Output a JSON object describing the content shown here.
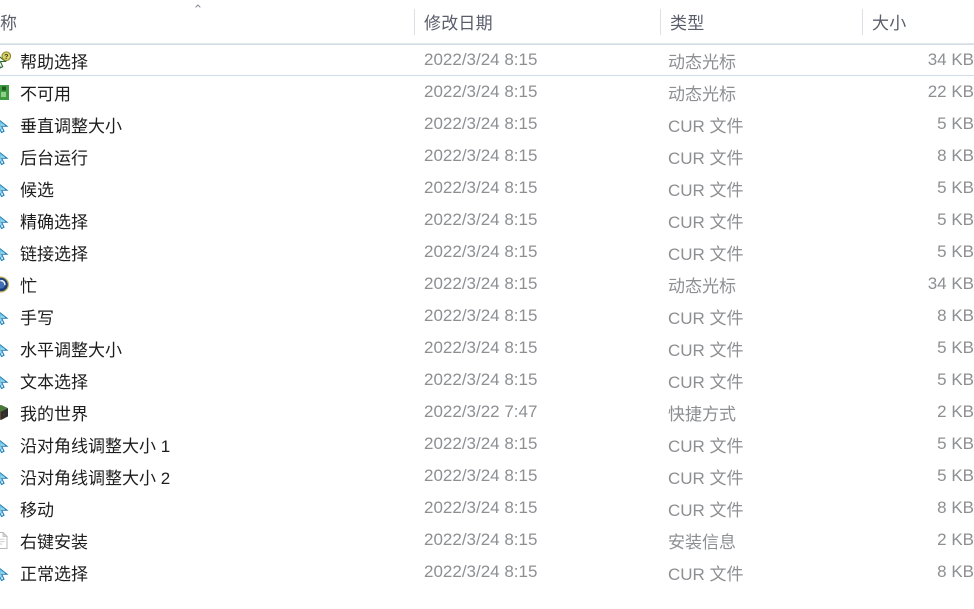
{
  "window": {
    "view": "details-list"
  },
  "columns": {
    "name": {
      "label": "称",
      "sort": "ascending",
      "sort_glyph": "⌃"
    },
    "date": {
      "label": "修改日期"
    },
    "type": {
      "label": "类型"
    },
    "size": {
      "label": "大小"
    }
  },
  "rows": [
    {
      "name": "帮助选择",
      "date": "2022/3/24 8:15",
      "type": "动态光标",
      "size": "34 KB",
      "icon": "ani-cursor-help-icon",
      "icon_colors": [
        "#d9d36a",
        "#2f6b2f",
        "#f2f2f2"
      ],
      "state": "hovered"
    },
    {
      "name": "不可用",
      "date": "2022/3/24 8:15",
      "type": "动态光标",
      "size": "22 KB",
      "icon": "ani-cursor-unavailable-icon",
      "icon_colors": [
        "#3f9b3f",
        "#1d5a1d",
        "#8ed18e"
      ],
      "state": "normal"
    },
    {
      "name": "垂直调整大小",
      "date": "2022/3/24 8:15",
      "type": "CUR 文件",
      "size": "5 KB",
      "icon": "cur-file-icon",
      "icon_colors": [
        "#6ec6e8",
        "#1f7fb5",
        "#eaf6fc"
      ],
      "state": "normal"
    },
    {
      "name": "后台运行",
      "date": "2022/3/24 8:15",
      "type": "CUR 文件",
      "size": "8 KB",
      "icon": "cur-file-icon",
      "icon_colors": [
        "#6ec6e8",
        "#1f7fb5",
        "#eaf6fc"
      ],
      "state": "normal"
    },
    {
      "name": "候选",
      "date": "2022/3/24 8:15",
      "type": "CUR 文件",
      "size": "5 KB",
      "icon": "cur-file-icon",
      "icon_colors": [
        "#6ec6e8",
        "#1f7fb5",
        "#eaf6fc"
      ],
      "state": "normal"
    },
    {
      "name": "精确选择",
      "date": "2022/3/24 8:15",
      "type": "CUR 文件",
      "size": "5 KB",
      "icon": "cur-file-icon",
      "icon_colors": [
        "#6ec6e8",
        "#1f7fb5",
        "#eaf6fc"
      ],
      "state": "normal"
    },
    {
      "name": "链接选择",
      "date": "2022/3/24 8:15",
      "type": "CUR 文件",
      "size": "5 KB",
      "icon": "cur-file-icon",
      "icon_colors": [
        "#6ec6e8",
        "#1f7fb5",
        "#eaf6fc"
      ],
      "state": "normal"
    },
    {
      "name": "忙",
      "date": "2022/3/24 8:15",
      "type": "动态光标",
      "size": "34 KB",
      "icon": "ani-cursor-busy-icon",
      "icon_colors": [
        "#1b3f79",
        "#c9b55a",
        "#4a78c0"
      ],
      "state": "normal"
    },
    {
      "name": "手写",
      "date": "2022/3/24 8:15",
      "type": "CUR 文件",
      "size": "8 KB",
      "icon": "cur-file-icon",
      "icon_colors": [
        "#6ec6e8",
        "#1f7fb5",
        "#eaf6fc"
      ],
      "state": "normal"
    },
    {
      "name": "水平调整大小",
      "date": "2022/3/24 8:15",
      "type": "CUR 文件",
      "size": "5 KB",
      "icon": "cur-file-icon",
      "icon_colors": [
        "#6ec6e8",
        "#1f7fb5",
        "#eaf6fc"
      ],
      "state": "normal"
    },
    {
      "name": "文本选择",
      "date": "2022/3/24 8:15",
      "type": "CUR 文件",
      "size": "5 KB",
      "icon": "cur-file-icon",
      "icon_colors": [
        "#6ec6e8",
        "#1f7fb5",
        "#eaf6fc"
      ],
      "state": "normal"
    },
    {
      "name": "我的世界",
      "date": "2022/3/22 7:47",
      "type": "快捷方式",
      "size": "2 KB",
      "icon": "minecraft-shortcut-icon",
      "icon_colors": [
        "#4a7a3a",
        "#6b4a2a",
        "#2d2d2d"
      ],
      "state": "normal"
    },
    {
      "name": "沿对角线调整大小 1",
      "date": "2022/3/24 8:15",
      "type": "CUR 文件",
      "size": "5 KB",
      "icon": "cur-file-icon",
      "icon_colors": [
        "#6ec6e8",
        "#1f7fb5",
        "#eaf6fc"
      ],
      "state": "normal"
    },
    {
      "name": "沿对角线调整大小 2",
      "date": "2022/3/24 8:15",
      "type": "CUR 文件",
      "size": "5 KB",
      "icon": "cur-file-icon",
      "icon_colors": [
        "#6ec6e8",
        "#1f7fb5",
        "#eaf6fc"
      ],
      "state": "normal"
    },
    {
      "name": "移动",
      "date": "2022/3/24 8:15",
      "type": "CUR 文件",
      "size": "8 KB",
      "icon": "cur-file-icon",
      "icon_colors": [
        "#6ec6e8",
        "#1f7fb5",
        "#eaf6fc"
      ],
      "state": "normal"
    },
    {
      "name": "右键安装",
      "date": "2022/3/24 8:15",
      "type": "安装信息",
      "size": "2 KB",
      "icon": "inf-file-icon",
      "icon_colors": [
        "#ffffff",
        "#b8b8b8",
        "#d9d9d9"
      ],
      "state": "normal"
    },
    {
      "name": "正常选择",
      "date": "2022/3/24 8:15",
      "type": "CUR 文件",
      "size": "8 KB",
      "icon": "cur-file-icon",
      "icon_colors": [
        "#6ec6e8",
        "#1f7fb5",
        "#eaf6fc"
      ],
      "state": "normal"
    }
  ],
  "theme": {
    "name_text": "#1d1d1d",
    "meta_text": "#8d8f92",
    "header_text": "#5a5e6b",
    "separator": "#dcdfe4",
    "hover_border": "#cfdeea",
    "background": "#ffffff"
  }
}
